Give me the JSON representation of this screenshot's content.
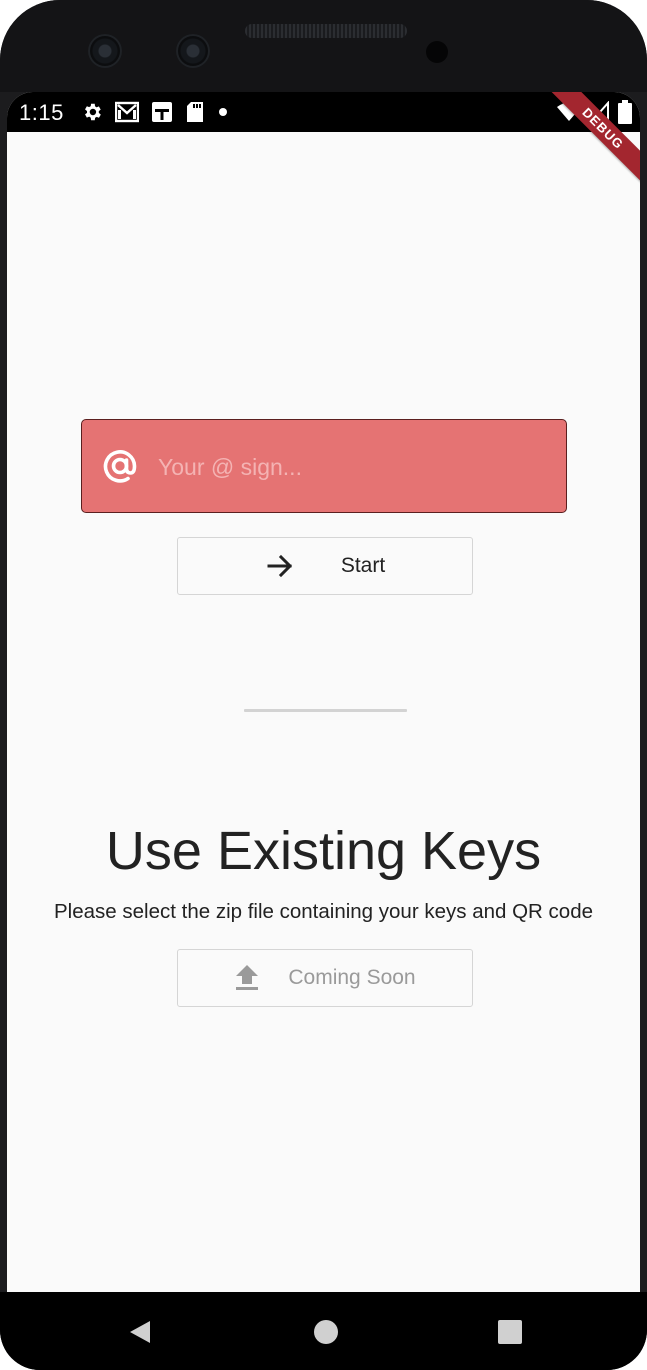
{
  "status_bar": {
    "time": "1:15",
    "left_icons": [
      "gear-icon",
      "gmail-icon",
      "calendar-icon",
      "sd-card-icon",
      "dot-icon"
    ],
    "right_icons": [
      "wifi-icon",
      "signal-icon",
      "battery-icon"
    ]
  },
  "debug_banner": "DEBUG",
  "login": {
    "at_sign_placeholder": "Your @ sign...",
    "at_sign_value": "",
    "start_label": "Start"
  },
  "existing_keys": {
    "title": "Use Existing Keys",
    "description": "Please select the zip file containing your keys and QR code",
    "coming_soon_label": "Coming Soon"
  },
  "colors": {
    "field_background": "#e57373",
    "screen_background": "#fafafa",
    "debug_ribbon": "#a3262f"
  }
}
